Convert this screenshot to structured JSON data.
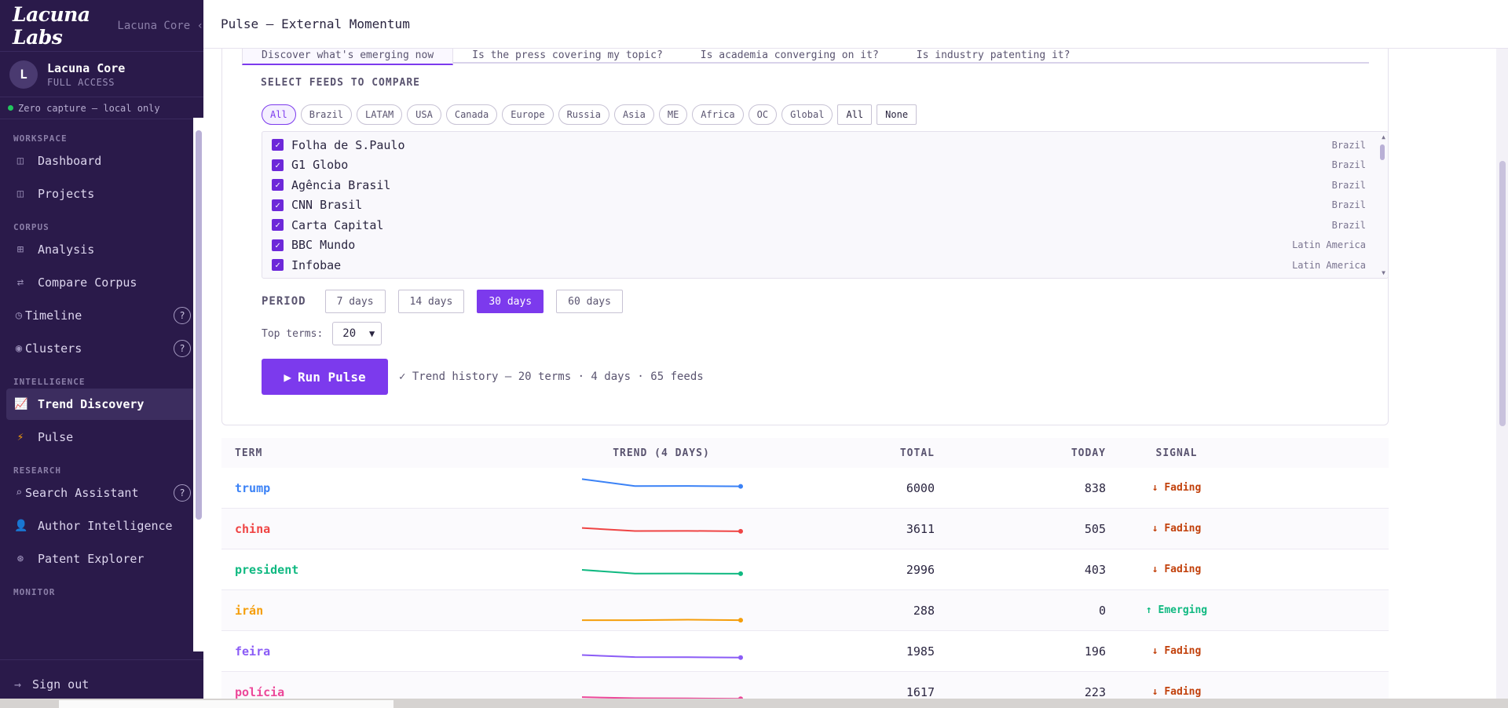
{
  "brand": {
    "logo": "Lacuna Labs",
    "product": "Lacuna Core ‹"
  },
  "user": {
    "initial": "L",
    "name": "Lacuna Core",
    "role": "FULL ACCESS"
  },
  "privacy": "Zero capture — local only",
  "nav": {
    "workspace": "WORKSPACE",
    "dashboard": "Dashboard",
    "projects": "Projects",
    "corpus": "CORPUS",
    "analysis": "Analysis",
    "compare": "Compare Corpus",
    "timeline": "Timeline",
    "clusters": "Clusters",
    "intelligence": "INTELLIGENCE",
    "trend": "Trend Discovery",
    "pulse": "Pulse",
    "research": "RESEARCH",
    "search": "Search Assistant",
    "author": "Author Intelligence",
    "patent": "Patent Explorer",
    "monitor": "MONITOR",
    "help": "?",
    "signout": "Sign out"
  },
  "page": {
    "title": "Pulse — External Momentum"
  },
  "tabs": [
    "Discover what's emerging now",
    "Is the press covering my topic?",
    "Is academia converging on it?",
    "Is industry patenting it?"
  ],
  "feeds_section": "SELECT FEEDS TO COMPARE",
  "chips": [
    "All",
    "Brazil",
    "LATAM",
    "USA",
    "Canada",
    "Europe",
    "Russia",
    "Asia",
    "ME",
    "Africa",
    "OC",
    "Global"
  ],
  "chip_all": "All",
  "chip_none": "None",
  "feeds": [
    {
      "name": "Folha de S.Paulo",
      "region": "Brazil"
    },
    {
      "name": "G1 Globo",
      "region": "Brazil"
    },
    {
      "name": "Agência Brasil",
      "region": "Brazil"
    },
    {
      "name": "CNN Brasil",
      "region": "Brazil"
    },
    {
      "name": "Carta Capital",
      "region": "Brazil"
    },
    {
      "name": "BBC Mundo",
      "region": "Latin America"
    },
    {
      "name": "Infobae",
      "region": "Latin America"
    }
  ],
  "period": {
    "label": "PERIOD",
    "options": [
      "7 days",
      "14 days",
      "30 days",
      "60 days"
    ]
  },
  "top_terms": {
    "label": "Top terms:",
    "value": "20"
  },
  "run": {
    "label": "Run Pulse",
    "status": "✓ Trend history — 20 terms · 4 days · 65 feeds"
  },
  "table": {
    "headers": {
      "term": "TERM",
      "trend": "TREND (4 DAYS)",
      "total": "TOTAL",
      "today": "TODAY",
      "signal": "SIGNAL"
    },
    "rows": [
      {
        "term": "trump",
        "total": "6000",
        "today": "838",
        "signal": "↓ Fading",
        "signal_type": "fading",
        "color": "#3b82f6",
        "trend": [
          1800,
          1150,
          1160,
          1120
        ]
      },
      {
        "term": "china",
        "total": "3611",
        "today": "505",
        "signal": "↓ Fading",
        "signal_type": "fading",
        "color": "#ef4444",
        "trend": [
          1050,
          770,
          780,
          740
        ]
      },
      {
        "term": "president",
        "total": "2996",
        "today": "403",
        "signal": "↓ Fading",
        "signal_type": "fading",
        "color": "#10b981",
        "trend": [
          950,
          600,
          610,
          590
        ]
      },
      {
        "term": "irán",
        "total": "288",
        "today": "0",
        "signal": "↑ Emerging",
        "signal_type": "emerging",
        "color": "#f59e0b",
        "trend": [
          60,
          60,
          110,
          60
        ]
      },
      {
        "term": "feira",
        "total": "1985",
        "today": "196",
        "signal": "↓ Fading",
        "signal_type": "fading",
        "color": "#8b5cf6",
        "trend": [
          620,
          430,
          420,
          380
        ]
      },
      {
        "term": "polícia",
        "total": "1617",
        "today": "223",
        "signal": "↓ Fading",
        "signal_type": "fading",
        "color": "#ec4899",
        "trend": [
          500,
          400,
          380,
          350
        ]
      }
    ]
  }
}
